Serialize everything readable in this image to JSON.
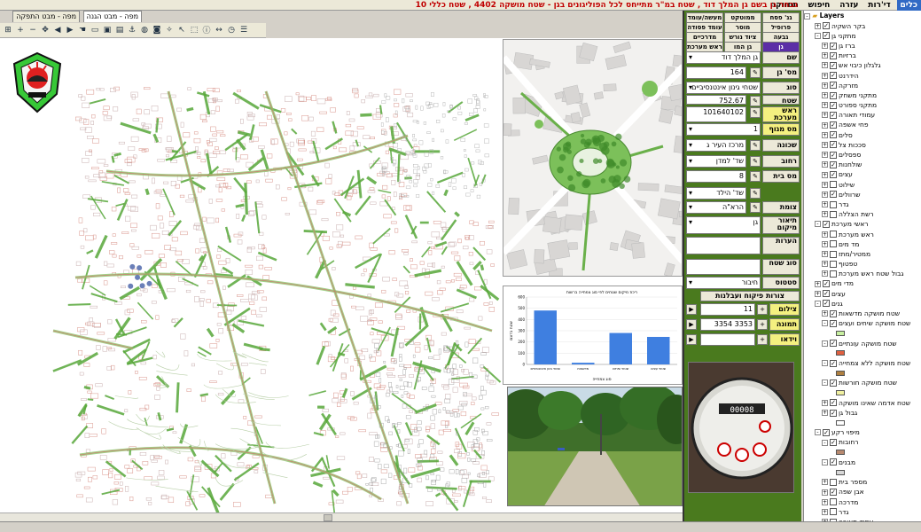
{
  "menu": {
    "items": [
      "כלים",
      "די'רות",
      "עזרה",
      "חיפוש",
      "תחזוקה"
    ]
  },
  "title": "גבחר גן בשם גן המלך דוד , שטח במ\"ר מתייחס לכל הפוליגונים בגן -  שטח מושקה 4402 , שטח כללי 10",
  "map_tabs": [
    "מפה - מבט הגנה",
    "מפה - מבט התפקה"
  ],
  "toolbar_icons": [
    "zoom-all-icon",
    "zoom-in-icon",
    "zoom-out-icon",
    "pan-icon",
    "arrow-left-icon",
    "arrow-right-icon",
    "hand-icon",
    "open-icon",
    "save-icon",
    "print-icon",
    "anchor-icon",
    "globe-icon",
    "camera-icon",
    "compass-icon",
    "select-icon",
    "select-area-icon",
    "info-icon",
    "measure-icon",
    "clock-icon",
    "layers-icon"
  ],
  "panel": {
    "tabs_row1": [
      "גנ' פסח",
      "ממוטקט",
      "מעשה/עומד"
    ],
    "tabs_row2": [
      "פרופיל",
      "מוסר",
      "עומד פסודה"
    ],
    "tabs_row3": [
      "גבעה",
      "ציוד נורש",
      "מדרכיים פסודה"
    ],
    "tabs_row4": [
      "גן",
      "גן המו",
      "ראש מערכת"
    ],
    "fields": [
      {
        "label": "שם",
        "value": "גן המלך דוד"
      },
      {
        "label": "מס' גן",
        "value": "164"
      },
      {
        "label": "סוג",
        "value": "שטחי גינון אינטנסיביים"
      },
      {
        "label": "שטח פוליגון",
        "value": "752.67"
      },
      {
        "label": "ראש מערכת",
        "value": "101640102"
      },
      {
        "label": "מס מגוף",
        "value": "1"
      },
      {
        "label": "שכונה",
        "value": "מרכז העיר ג"
      },
      {
        "label": "רחוב",
        "value": "שד' למדן"
      },
      {
        "label": "מס בית",
        "value": "8"
      },
      {
        "label": "",
        "value": "שד' הילד"
      },
      {
        "label": "צומת",
        "value": "הרא\"ה"
      },
      {
        "label": "תיאור מיקום",
        "value": "גן"
      },
      {
        "label": "הערות",
        "value": ""
      },
      {
        "label": "סוג שטח",
        "value": ""
      },
      {
        "label": "סטטוס",
        "value": "חיבור"
      }
    ],
    "button_wide": "צורות פיקוח ועבלנות",
    "photos_label": "צילום",
    "photos_value": "11",
    "image_label": "תמונה",
    "image_value": "3353 3354",
    "video_label": "וידאו",
    "video_value": ""
  },
  "chart_data": {
    "type": "bar",
    "title": "ריכוז מיקום שטחים לפי סוג צמחייה ברשות",
    "ylabel": "שטח בדונם",
    "xlabel": "סוג צמחייה",
    "categories": [
      "שטחי גינון אינטנסיביים",
      "מדשאות",
      "שטחי שיחים",
      "שטחי עצים"
    ],
    "values": [
      480,
      15,
      280,
      245
    ],
    "ylim": [
      0,
      600
    ],
    "ticks": [
      0,
      100,
      200,
      300,
      400,
      500,
      600
    ],
    "color": "#3f7fe0"
  },
  "layers": {
    "title": "Layers",
    "items": [
      {
        "t": "בקר השקיה",
        "lvl": 1,
        "ex": "+",
        "c": true
      },
      {
        "t": "מתקני גן",
        "lvl": 1,
        "ex": "-",
        "c": true
      },
      {
        "t": "ברז גן",
        "lvl": 2,
        "ex": "+",
        "c": true
      },
      {
        "t": "ברזיות",
        "lvl": 2,
        "ex": "+",
        "c": true
      },
      {
        "t": "גלגלון כיבוי אש",
        "lvl": 2,
        "ex": "+",
        "c": true
      },
      {
        "t": "הידרנט",
        "lvl": 2,
        "ex": "+",
        "c": true
      },
      {
        "t": "מזרקה",
        "lvl": 2,
        "ex": "+",
        "c": true
      },
      {
        "t": "מתקני משחק",
        "lvl": 2,
        "ex": "+",
        "c": true
      },
      {
        "t": "מתקני ספורט",
        "lvl": 2,
        "ex": "+",
        "c": true
      },
      {
        "t": "עמודי תאורה",
        "lvl": 2,
        "ex": "+",
        "c": true
      },
      {
        "t": "פחי אשפה",
        "lvl": 2,
        "ex": "+",
        "c": true
      },
      {
        "t": "סלים",
        "lvl": 2,
        "ex": "+",
        "c": true
      },
      {
        "t": "סככות צל",
        "lvl": 2,
        "ex": "+",
        "c": true
      },
      {
        "t": "ספסלים",
        "lvl": 2,
        "ex": "+",
        "c": true
      },
      {
        "t": "שולחנות",
        "lvl": 2,
        "ex": "+",
        "c": true
      },
      {
        "t": "עצים",
        "lvl": 2,
        "ex": "+",
        "c": true
      },
      {
        "t": "שילוט",
        "lvl": 2,
        "ex": "+",
        "c": false
      },
      {
        "t": "שרוולים",
        "lvl": 2,
        "ex": "+",
        "c": true
      },
      {
        "t": "גדר",
        "lvl": 2,
        "ex": "+",
        "c": false
      },
      {
        "t": "רשת הצללה",
        "lvl": 2,
        "ex": "+",
        "c": false
      },
      {
        "t": "ראשי מערכת",
        "lvl": 1,
        "ex": "-",
        "c": true
      },
      {
        "t": "ראש מערכת",
        "lvl": 2,
        "ex": "+",
        "c": false
      },
      {
        "t": "מד מים",
        "lvl": 2,
        "ex": "+",
        "c": false
      },
      {
        "t": "ממטיר/מתז",
        "lvl": 2,
        "ex": "+",
        "c": false
      },
      {
        "t": "טפטוף",
        "lvl": 2,
        "ex": "+",
        "c": false
      },
      {
        "t": "גבול שטח ראש מערכת",
        "lvl": 2,
        "ex": "+",
        "c": false
      },
      {
        "t": "מדי מים",
        "lvl": 1,
        "ex": "+",
        "c": true
      },
      {
        "t": "עצים",
        "lvl": 1,
        "ex": "+",
        "c": true
      },
      {
        "t": "גנים",
        "lvl": 1,
        "ex": "-",
        "c": true
      },
      {
        "t": "שטח מושקה מדשאות",
        "lvl": 2,
        "ex": "+",
        "c": true
      },
      {
        "t": "שטח מושקה שיחים ועצים",
        "lvl": 2,
        "ex": "-",
        "c": true
      },
      {
        "t": "",
        "lvl": 3,
        "sw": "#c8f0a0"
      },
      {
        "t": "שטח מושקה עונתיים",
        "lvl": 2,
        "ex": "-",
        "c": true
      },
      {
        "t": "",
        "lvl": 3,
        "sw": "#e06040"
      },
      {
        "t": "שטח מושקה ללא צמחייה",
        "lvl": 2,
        "ex": "-",
        "c": true
      },
      {
        "t": "",
        "lvl": 3,
        "sw": "#b08040"
      },
      {
        "t": "שטח מושקה חורשות",
        "lvl": 2,
        "ex": "-",
        "c": true
      },
      {
        "t": "",
        "lvl": 3,
        "sw": "#f0f0a0"
      },
      {
        "t": "שטח אדמה שאינו מושקה",
        "lvl": 2,
        "ex": "+",
        "c": true
      },
      {
        "t": "גבול גן",
        "lvl": 2,
        "ex": "+",
        "c": true
      },
      {
        "t": "",
        "lvl": 3,
        "sw": "#ffffff"
      },
      {
        "t": "מיפוי רקע",
        "lvl": 1,
        "ex": "-",
        "c": true
      },
      {
        "t": "רחובות",
        "lvl": 2,
        "ex": "-",
        "c": true
      },
      {
        "t": "",
        "lvl": 3,
        "sw": "#b88a70"
      },
      {
        "t": "מבנים",
        "lvl": 2,
        "ex": "-",
        "c": true
      },
      {
        "t": "",
        "lvl": 3,
        "sw": "#d8d8d8"
      },
      {
        "t": "מספר בית",
        "lvl": 2,
        "ex": "+",
        "c": false
      },
      {
        "t": "אבן שפה",
        "lvl": 2,
        "ex": "+",
        "c": true
      },
      {
        "t": "מדרכה",
        "lvl": 2,
        "ex": "+",
        "c": false
      },
      {
        "t": "גדר",
        "lvl": 2,
        "ex": "+",
        "c": false
      },
      {
        "t": "עמוד תאורה",
        "lvl": 2,
        "ex": "+",
        "c": false
      }
    ]
  }
}
